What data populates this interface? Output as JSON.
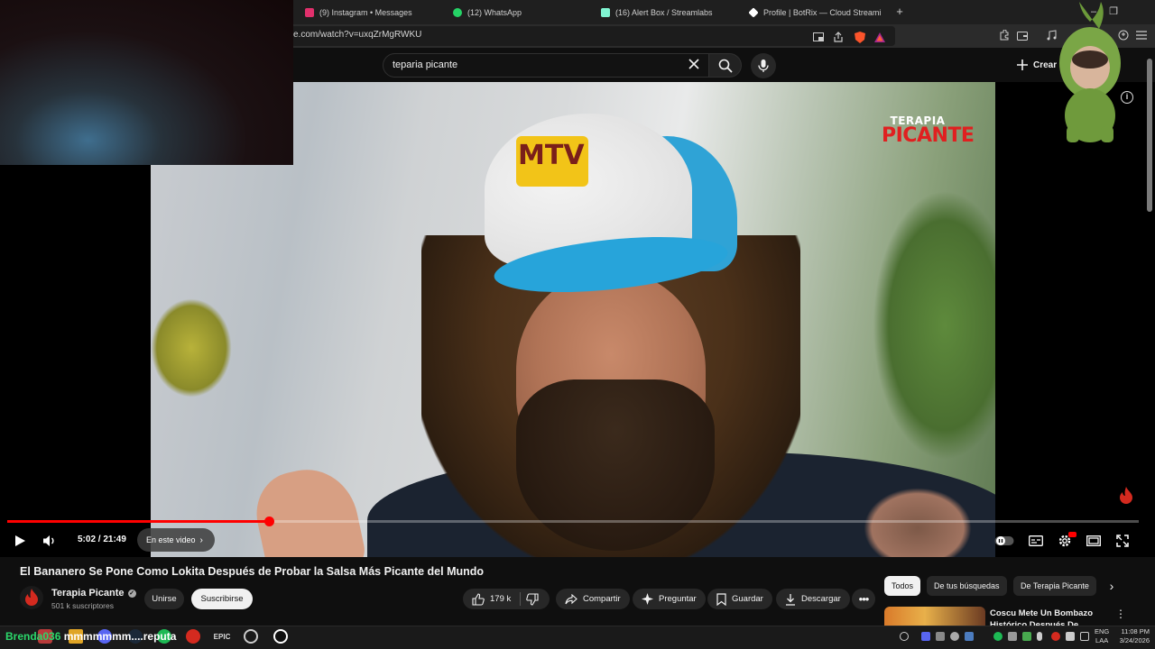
{
  "browser": {
    "tabs": [
      {
        "label": "(9) Instagram • Messages",
        "icon": "instagram-icon",
        "color": "#e1306c"
      },
      {
        "label": "(12) WhatsApp",
        "icon": "whatsapp-icon",
        "color": "#25d366"
      },
      {
        "label": "(16) Alert Box / Streamlabs",
        "icon": "streamlabs-icon",
        "color": "#80f5d2"
      },
      {
        "label": "Profile | BotRix — Cloud Streaming B",
        "icon": "botrix-icon",
        "color": "#ffffff"
      }
    ],
    "new_tab": "+",
    "url": "e.com/watch?v=uxqZrMgRWKU"
  },
  "youtube": {
    "search_value": "teparia picante",
    "create_label": "Crear",
    "video": {
      "logo_line1": "TERAPIA",
      "logo_line2": "PICANTE",
      "cap_text": "MTV",
      "time": "5:02 / 21:49",
      "chapter": "En este video",
      "progress": 0.231
    },
    "title": "El Bananero Se Pone Como Lokita Después de Probar la Salsa Más Picante del Mundo",
    "channel": {
      "name": "Terapia Picante",
      "subscribers": "501 k suscriptores",
      "join_label": "Unirse",
      "subscribe_label": "Suscribirse"
    },
    "actions": {
      "likes": "179 k",
      "share": "Compartir",
      "ask": "Preguntar",
      "save": "Guardar",
      "download": "Descargar"
    },
    "chips": [
      "Todos",
      "De tus búsquedas",
      "De Terapia Picante"
    ],
    "recommendation": {
      "title": "Coscu Mete Un Bombazo Histórico Después De Probar"
    }
  },
  "overlay": {
    "chat_user": "Brenda036",
    "chat_message": "mmmmmmm....reputa"
  },
  "taskbar": {
    "lang_line1": "ENG",
    "lang_line2": "LAA",
    "time": "11:08 PM",
    "date": "3/24/2026"
  },
  "colors": {
    "accent_red": "#ff0000",
    "background": "#0f0f0f",
    "chip_active": "#f1f1f1",
    "chat_user": "#2bd96b"
  }
}
